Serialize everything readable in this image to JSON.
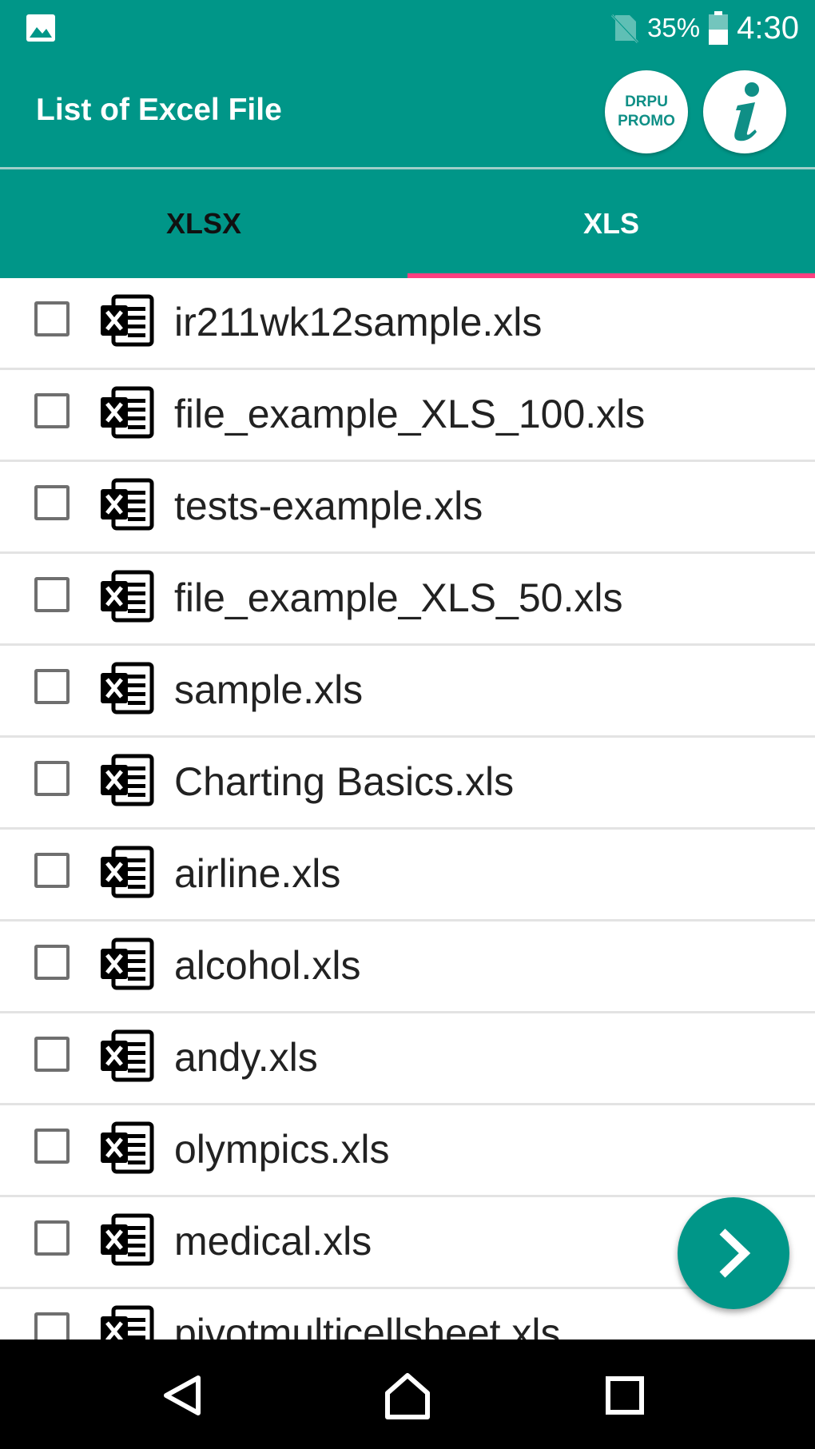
{
  "status_bar": {
    "gallery_icon": "image-icon",
    "signal_icon": "no-sim-icon",
    "battery_percent": "35%",
    "battery_icon": "battery-icon",
    "time": "4:30"
  },
  "app_bar": {
    "title": "List of Excel File",
    "promo_line1": "DRPU",
    "promo_line2": "PROMO",
    "info_icon": "info-icon"
  },
  "tabs": [
    {
      "label": "XLSX",
      "active": false
    },
    {
      "label": "XLS",
      "active": true
    }
  ],
  "colors": {
    "primary": "#009688",
    "accent": "#ff4081",
    "background": "#ffffff"
  },
  "files": [
    {
      "name": "ir211wk12sample.xls",
      "checked": false
    },
    {
      "name": "file_example_XLS_100.xls",
      "checked": false
    },
    {
      "name": "tests-example.xls",
      "checked": false
    },
    {
      "name": "file_example_XLS_50.xls",
      "checked": false
    },
    {
      "name": "sample.xls",
      "checked": false
    },
    {
      "name": "Charting Basics.xls",
      "checked": false
    },
    {
      "name": "airline.xls",
      "checked": false
    },
    {
      "name": "alcohol.xls",
      "checked": false
    },
    {
      "name": "andy.xls",
      "checked": false
    },
    {
      "name": "olympics.xls",
      "checked": false
    },
    {
      "name": "medical.xls",
      "checked": false
    },
    {
      "name": "pivotmulticellsheet.xls",
      "checked": false
    }
  ],
  "fab": {
    "icon": "chevron-right-icon"
  },
  "nav_bar": {
    "back_icon": "back-icon",
    "home_icon": "home-icon",
    "recents_icon": "recents-icon"
  }
}
